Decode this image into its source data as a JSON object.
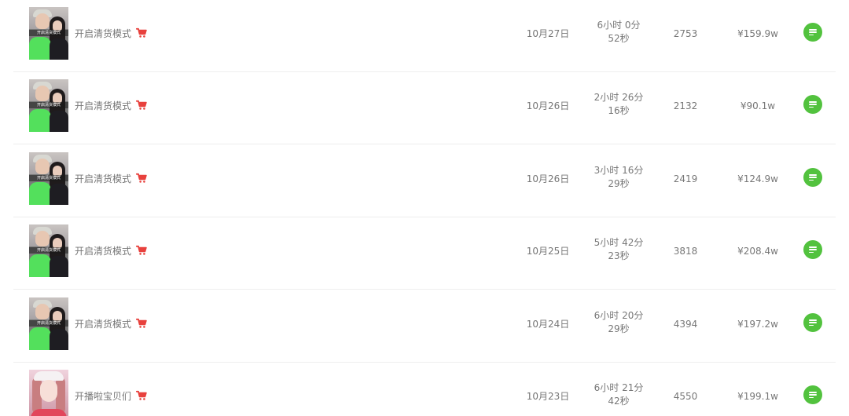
{
  "colors": {
    "accent_green": "#52c23e",
    "cart_red": "#e8413d",
    "text_gray": "#777777",
    "divider": "#eeeeee"
  },
  "rows": [
    {
      "title": "开启清货模式",
      "thumb_caption": "开启清货模式",
      "date": "10月27日",
      "duration_line1": "6小时 0分",
      "duration_line2": "52秒",
      "viewers": "2753",
      "sales": "¥159.9w",
      "thumb": "couple-green-shirt",
      "cart_icon": "cart-icon",
      "detail_icon": "list-detail-icon"
    },
    {
      "title": "开启清货模式",
      "thumb_caption": "开启清货模式",
      "date": "10月26日",
      "duration_line1": "2小时 26分",
      "duration_line2": "16秒",
      "viewers": "2132",
      "sales": "¥90.1w",
      "thumb": "couple-green-shirt",
      "cart_icon": "cart-icon",
      "detail_icon": "list-detail-icon"
    },
    {
      "title": "开启清货模式",
      "thumb_caption": "开启清货模式",
      "date": "10月26日",
      "duration_line1": "3小时 16分",
      "duration_line2": "29秒",
      "viewers": "2419",
      "sales": "¥124.9w",
      "thumb": "couple-green-shirt",
      "cart_icon": "cart-icon",
      "detail_icon": "list-detail-icon"
    },
    {
      "title": "开启清货模式",
      "thumb_caption": "开启清货模式",
      "date": "10月25日",
      "duration_line1": "5小时 42分",
      "duration_line2": "23秒",
      "viewers": "3818",
      "sales": "¥208.4w",
      "thumb": "couple-green-shirt",
      "cart_icon": "cart-icon",
      "detail_icon": "list-detail-icon"
    },
    {
      "title": "开启清货模式",
      "thumb_caption": "开启清货模式",
      "date": "10月24日",
      "duration_line1": "6小时 20分",
      "duration_line2": "29秒",
      "viewers": "4394",
      "sales": "¥197.2w",
      "thumb": "couple-green-shirt",
      "cart_icon": "cart-icon",
      "detail_icon": "list-detail-icon"
    },
    {
      "title": "开播啦宝贝们",
      "date": "10月23日",
      "duration_line1": "6小时 21分",
      "duration_line2": "42秒",
      "viewers": "4550",
      "sales": "¥199.1w",
      "thumb": "girl-white-hat",
      "cart_icon": "cart-icon",
      "detail_icon": "list-detail-icon"
    }
  ]
}
